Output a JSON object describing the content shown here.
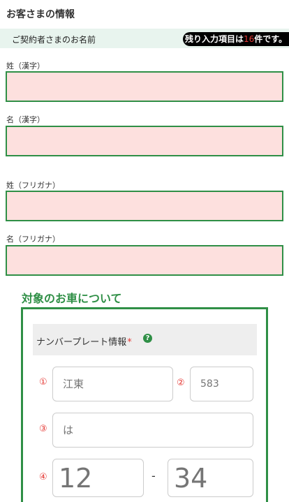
{
  "customer": {
    "section_title": "お客さまの情報",
    "name_header": "ご契約者さまのお名前",
    "remaining": {
      "prefix": "残り入力項目は",
      "count": "16",
      "suffix": "件です。"
    },
    "fields": [
      {
        "label": "姓（漢字）",
        "value": ""
      },
      {
        "label": "名（漢字）",
        "value": ""
      },
      {
        "label": "姓（フリガナ）",
        "value": ""
      },
      {
        "label": "名（フリガナ）",
        "value": ""
      }
    ]
  },
  "vehicle": {
    "section_title": "対象のお車について",
    "plate_header": "ナンバープレート情報",
    "required_mark": "*",
    "help_icon": "question-circle-icon",
    "markers": [
      "①",
      "②",
      "③",
      "④"
    ],
    "placeholders": {
      "region": "江東",
      "class_number": "583",
      "hiragana": "は",
      "number_left": "12",
      "number_right": "34"
    },
    "dash": "-"
  },
  "colors": {
    "accent_green": "#2f8f46",
    "input_error_bg": "#fde0de",
    "required_red": "#e53935",
    "header_band": "#e8f4ee"
  }
}
